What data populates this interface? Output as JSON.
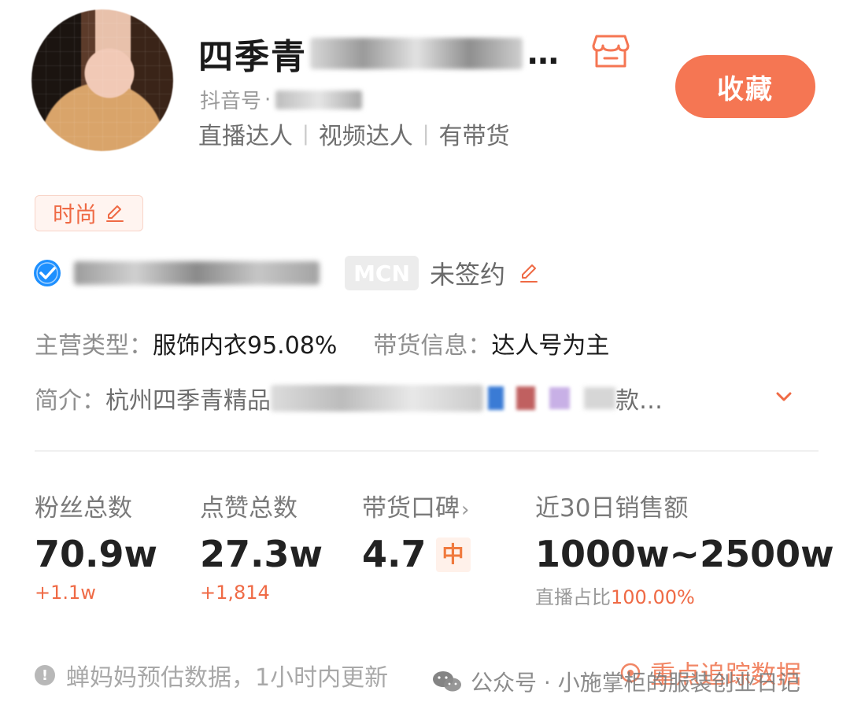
{
  "profile": {
    "name_visible": "四季青",
    "name_ellipsis": "…",
    "douyin_id_label": "抖音号",
    "douyin_id_separator": "·",
    "roles": [
      "直播达人",
      "视频达人",
      "有带货"
    ]
  },
  "actions": {
    "favorite_label": "收藏"
  },
  "category_tag": "时尚",
  "mcn": {
    "badge": "MCN",
    "status": "未签约"
  },
  "business": {
    "main_type_label": "主营类型：",
    "main_type_value": "服饰内衣95.08%",
    "sales_info_label": "带货信息：",
    "sales_info_value": "达人号为主"
  },
  "intro": {
    "label": "简介：",
    "text_start": "杭州四季青精品",
    "text_end": "款…"
  },
  "stats": {
    "followers": {
      "label": "粉丝总数",
      "value": "70.9w",
      "delta": "+1.1w"
    },
    "likes": {
      "label": "点赞总数",
      "value": "27.3w",
      "delta": "+1,814"
    },
    "reputation": {
      "label": "带货口碑",
      "arrow": "›",
      "value": "4.7",
      "level": "中"
    },
    "sales30": {
      "label": "近30日销售额",
      "value": "1000w~2500w",
      "live_share_label": "直播占比",
      "live_share_value": "100.00%"
    }
  },
  "footer": {
    "note": "蝉妈妈预估数据，1小时内更新",
    "track_label": "重点追踪数据"
  },
  "watermark": {
    "text": "公众号 · 小施掌柜的服装创业日记"
  },
  "colors": {
    "accent": "#f57653",
    "accent_text": "#ef6a45",
    "verify_blue": "#1e90ff"
  }
}
